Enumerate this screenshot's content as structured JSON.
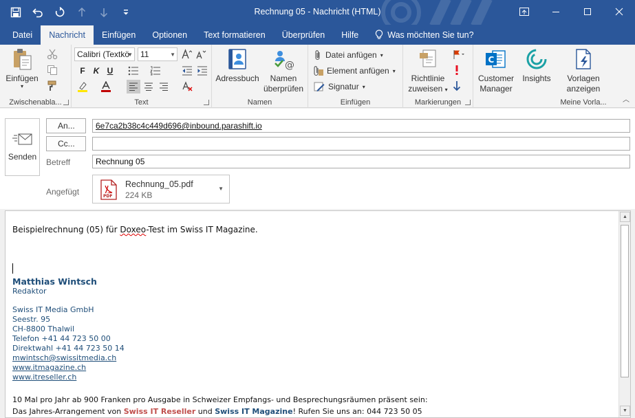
{
  "window": {
    "title": "Rechnung 05  -  Nachricht (HTML)"
  },
  "tabs": [
    {
      "label": "Datei",
      "active": false
    },
    {
      "label": "Nachricht",
      "active": true
    },
    {
      "label": "Einfügen",
      "active": false
    },
    {
      "label": "Optionen",
      "active": false
    },
    {
      "label": "Text formatieren",
      "active": false
    },
    {
      "label": "Überprüfen",
      "active": false
    },
    {
      "label": "Hilfe",
      "active": false
    }
  ],
  "tell_me": "Was möchten Sie tun?",
  "ribbon": {
    "clipboard": {
      "paste": "Einfügen",
      "label": "Zwischenabla..."
    },
    "text": {
      "font": "Calibri (Textkö",
      "size": "11",
      "bold": "F",
      "italic": "K",
      "underline": "U",
      "label": "Text"
    },
    "names": {
      "address_book": "Adressbuch",
      "check_names_1": "Namen",
      "check_names_2": "überprüfen",
      "label": "Namen"
    },
    "include": {
      "attach_file": "Datei anfügen",
      "attach_item": "Element anfügen",
      "signature": "Signatur",
      "label": "Einfügen"
    },
    "tags": {
      "policy_1": "Richtlinie",
      "policy_2": "zuweisen",
      "label": "Markierungen"
    },
    "addins": {
      "crm_1": "Customer",
      "crm_2": "Manager",
      "insights": "Insights",
      "templates_1": "Vorlagen",
      "templates_2": "anzeigen",
      "label": "Meine Vorla..."
    }
  },
  "header": {
    "send": "Senden",
    "to_label": "An...",
    "to_value": "6e7ca2b38c4c449d696@inbound.parashift.io",
    "cc_label": "Cc...",
    "cc_value": "",
    "subject_label": "Betreff",
    "subject_value": "Rechnung 05",
    "attached_label": "Angefügt",
    "attachment": {
      "name": "Rechnung_05.pdf",
      "size": "224 KB",
      "icon_text": "PDF"
    }
  },
  "body": {
    "intro_pre": "Beispielrechnung (05) für ",
    "intro_word": "Doxeo",
    "intro_post": "-Test im Swiss IT Magazine.",
    "sig_name": "Matthias Wintsch",
    "sig_role": "Redaktor",
    "company": "Swiss IT Media GmbH",
    "street": "Seestr. 95",
    "city": "CH-8800 Thalwil",
    "phone": "Telefon +41 44 723 50 00",
    "direct": "Direktwahl +41 44 723 50 14",
    "email": "mwintsch@swissitmedia.ch",
    "web1": "www.itmagazine.ch",
    "web2": "www.itreseller.ch",
    "promo": "10 Mal pro Jahr ab 900 Franken pro Ausgabe in Schweizer Empfangs- und Besprechungsräumen präsent sein:",
    "promo2_pre": "Das Jahres-Arrangement von ",
    "promo2_b1": "Swiss IT Reseller",
    "promo2_mid": " und ",
    "promo2_b2": "Swiss IT Magazine",
    "promo2_post": "! Rufen Sie uns an: 044 723 50 05"
  },
  "colors": {
    "accent": "#2b579a",
    "signature": "#1f4e79",
    "brand_red": "#c0504d"
  }
}
